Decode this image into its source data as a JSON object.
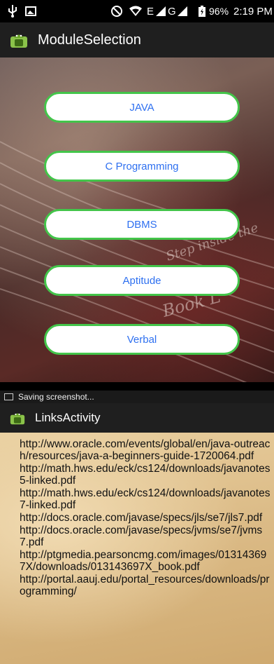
{
  "status_bar": {
    "battery": "96%",
    "time": "2:19 PM",
    "network": "E",
    "network2": "G"
  },
  "module_screen": {
    "title": "ModuleSelection",
    "modules": [
      "JAVA",
      "C Programming",
      "DBMS",
      "Aptitude",
      "Verbal"
    ],
    "background_text": [
      "Step inside the",
      "Book L"
    ]
  },
  "toast": {
    "text": "Saving screenshot..."
  },
  "links_screen": {
    "title": "LinksActivity",
    "links": [
      "http://www.oracle.com/events/global/en/java-outreach/resources/java-a-beginners-guide-1720064.pdf",
      "http://math.hws.edu/eck/cs124/downloads/javanotes5-linked.pdf",
      "http://math.hws.edu/eck/cs124/downloads/javanotes7-linked.pdf",
      "http://docs.oracle.com/javase/specs/jls/se7/jls7.pdf",
      "http://docs.oracle.com/javase/specs/jvms/se7/jvms7.pdf",
      "http://ptgmedia.pearsoncmg.com/images/013143697X/downloads/013143697X_book.pdf",
      "http://portal.aauj.edu/portal_resources/downloads/programming/"
    ]
  },
  "colors": {
    "accent_border": "#43c54a",
    "button_text": "#2e70f0",
    "action_bar": "#1f1f1f",
    "android_green": "#8bc34a"
  },
  "icons": [
    "usb-icon",
    "image-icon",
    "do-not-disturb-icon",
    "wifi-icon",
    "signal-icon",
    "battery-icon",
    "android-app-icon",
    "screenshot-icon"
  ]
}
